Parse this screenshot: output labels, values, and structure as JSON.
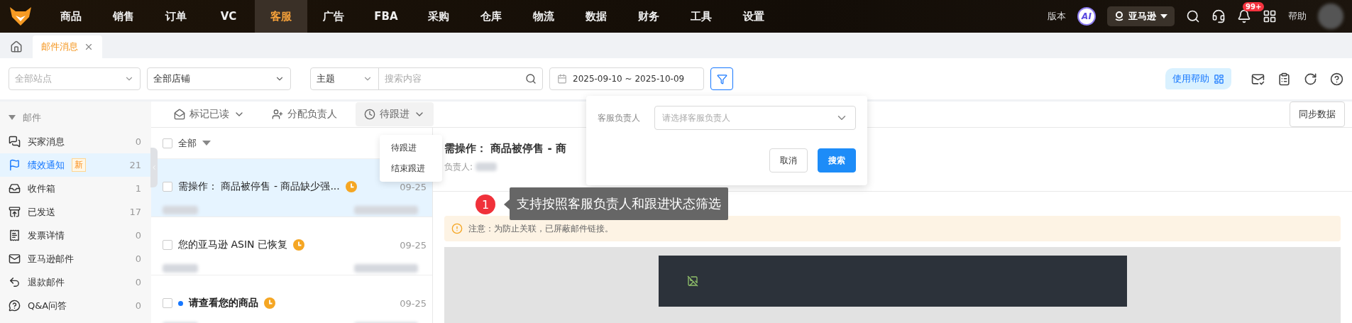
{
  "nav": {
    "items": [
      {
        "label": "商品",
        "selected": false
      },
      {
        "label": "销售",
        "selected": false
      },
      {
        "label": "订单",
        "selected": false
      },
      {
        "label": "VC",
        "selected": false
      },
      {
        "label": "客服",
        "selected": true
      },
      {
        "label": "广告",
        "selected": false
      },
      {
        "label": "FBA",
        "selected": false
      },
      {
        "label": "采购",
        "selected": false
      },
      {
        "label": "仓库",
        "selected": false
      },
      {
        "label": "物流",
        "selected": false
      },
      {
        "label": "数据",
        "selected": false
      },
      {
        "label": "财务",
        "selected": false
      },
      {
        "label": "工具",
        "selected": false
      },
      {
        "label": "设置",
        "selected": false
      }
    ],
    "version": "版本",
    "ai": "AI",
    "platform": "亚马逊",
    "badge": "99+",
    "help": "帮助"
  },
  "tabs": [
    {
      "label": "邮件消息",
      "selected": true
    }
  ],
  "filters": {
    "site": {
      "placeholder": "全部站点"
    },
    "shop": {
      "value": "全部店铺"
    },
    "search_field": {
      "value": "主题"
    },
    "search": {
      "placeholder": "搜索内容"
    },
    "date_range": "2025-09-10 ~ 2025-10-09",
    "help": "使用帮助"
  },
  "sidebar": {
    "title": "邮件",
    "expanded": true,
    "items": [
      {
        "label": "买家消息",
        "count": "0",
        "selected": false
      },
      {
        "label": "绩效通知",
        "badge": "新",
        "count": "21",
        "selected": true
      },
      {
        "label": "收件箱",
        "count": "1",
        "selected": false
      },
      {
        "label": "已发送",
        "count": "17",
        "selected": false
      },
      {
        "label": "发票详情",
        "count": "0",
        "selected": false
      },
      {
        "label": "亚马逊邮件",
        "count": "0",
        "selected": false
      },
      {
        "label": "退款邮件",
        "count": "0",
        "selected": false
      },
      {
        "label": "Q&A问答",
        "count": "0",
        "selected": false
      }
    ]
  },
  "toolbar": {
    "actions": [
      {
        "label": "标记已读",
        "kind": "dropdown",
        "expanded": false
      },
      {
        "label": "分配负责人",
        "kind": "plain",
        "expanded": false
      },
      {
        "label": "待跟进",
        "kind": "dropdown",
        "expanded": true
      }
    ],
    "menu": [
      "待跟进",
      "结束跟进"
    ],
    "sync": "同步数据"
  },
  "list": {
    "select_all": "全部",
    "checked": false,
    "items": [
      {
        "title": "需操作：  商品被停售 - 商品缺少强...",
        "date": "09-25",
        "selected": true,
        "unread": false,
        "checked": false
      },
      {
        "title": "您的亚马逊 ASIN 已恢复",
        "date": "09-25",
        "selected": false,
        "unread": false,
        "checked": false
      },
      {
        "title": "请查看您的商品",
        "date": "09-25",
        "selected": false,
        "unread": true,
        "checked": false
      }
    ]
  },
  "detail": {
    "title": "需操作：  商品被停售 - 商",
    "owner_label": "负责人:",
    "notice": "注意：为防止关联，已屏蔽邮件链接。"
  },
  "popover": {
    "label": "客服负责人",
    "placeholder": "请选择客服负责人",
    "buttons": [
      {
        "label": "取消",
        "kind": "default"
      },
      {
        "label": "搜索",
        "kind": "primary"
      }
    ]
  },
  "annotation": {
    "number": "1",
    "text": "支持按照客服负责人和跟进状态筛选"
  }
}
